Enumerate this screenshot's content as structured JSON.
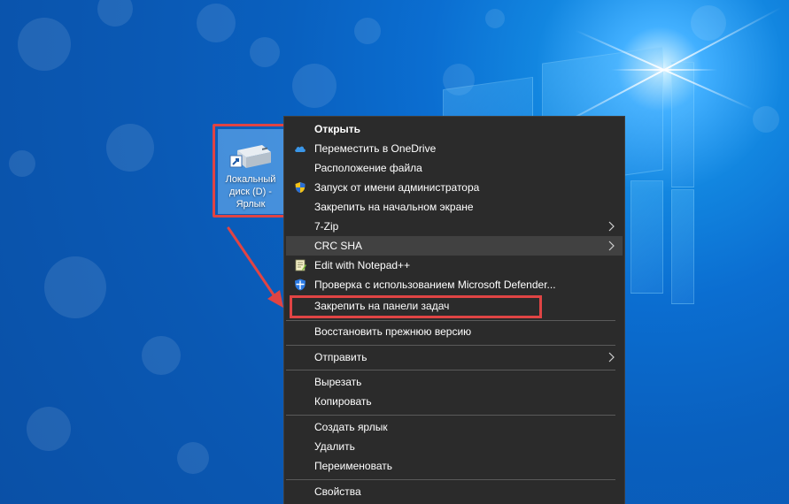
{
  "desktop": {
    "icon_label": "Локальный\nдиск (D) -\nЯрлык"
  },
  "context_menu": {
    "items": [
      {
        "label": "Открыть",
        "icon": "none"
      },
      {
        "label": "Переместить в OneDrive",
        "icon": "onedrive-cloud-icon"
      },
      {
        "label": "Расположение файла",
        "icon": "none"
      },
      {
        "label": "Запуск от имени администратора",
        "icon": "uac-shield-icon"
      },
      {
        "label": "Закрепить на начальном экране",
        "icon": "none"
      },
      {
        "label": "7-Zip",
        "icon": "none"
      },
      {
        "label": "CRC SHA",
        "icon": "none"
      },
      {
        "label": "Edit with Notepad++",
        "icon": "notepad-plus-plus-icon"
      },
      {
        "label": "Проверка с использованием Microsoft Defender...",
        "icon": "defender-shield-icon"
      },
      {
        "label": "Закрепить на панели задач",
        "icon": "none"
      },
      {
        "label": "Восстановить прежнюю версию",
        "icon": "none"
      },
      {
        "label": "Отправить",
        "icon": "none"
      },
      {
        "label": "Вырезать",
        "icon": "none"
      },
      {
        "label": "Копировать",
        "icon": "none"
      },
      {
        "label": "Создать ярлык",
        "icon": "none"
      },
      {
        "label": "Удалить",
        "icon": "none"
      },
      {
        "label": "Переименовать",
        "icon": "none"
      },
      {
        "label": "Свойства",
        "icon": "none"
      }
    ],
    "highlighted_item": "CRC SHA"
  },
  "colors": {
    "menu_background": "#2b2b2b",
    "menu_hover": "#414141",
    "annotation_red": "#e04444",
    "desktop_blue": "#0b6ed1"
  }
}
